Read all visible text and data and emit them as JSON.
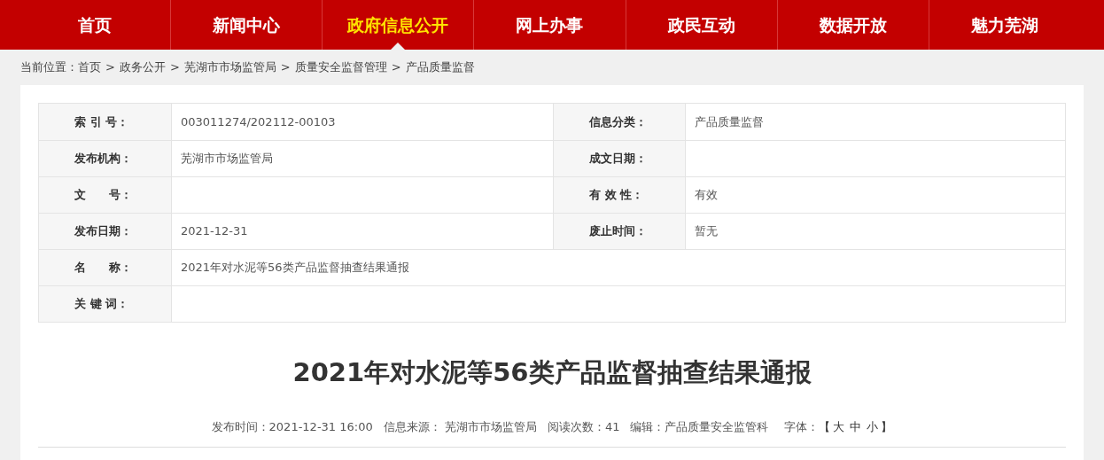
{
  "nav": [
    {
      "label": "首页",
      "selected": false
    },
    {
      "label": "新闻中心",
      "selected": false
    },
    {
      "label": "政府信息公开",
      "selected": true
    },
    {
      "label": "网上办事",
      "selected": false
    },
    {
      "label": "政民互动",
      "selected": false
    },
    {
      "label": "数据开放",
      "selected": false
    },
    {
      "label": "魅力芜湖",
      "selected": false
    }
  ],
  "breadcrumb": {
    "prefix": "当前位置：",
    "items": [
      "首页",
      "政务公开",
      "芜湖市市场监管局",
      "质量安全监督管理",
      "产品质量监督"
    ],
    "separator": ">"
  },
  "info_table": [
    {
      "cells": [
        {
          "label": "索 引 号：",
          "value": "003011274/202112-00103"
        },
        {
          "label": "信息分类：",
          "value": "产品质量监督"
        }
      ]
    },
    {
      "cells": [
        {
          "label": "发布机构：",
          "value": "芜湖市市场监管局"
        },
        {
          "label": "成文日期："
        }
      ]
    },
    {
      "cells": [
        {
          "label": "文　　号："
        },
        {
          "label": "有 效 性：",
          "value": "有效"
        }
      ]
    },
    {
      "cells": [
        {
          "label": "发布日期：",
          "value": "2021-12-31"
        },
        {
          "label": "废止时间：",
          "value": "暂无"
        }
      ]
    },
    {
      "cells": [
        {
          "label": "名　　称：",
          "value": "2021年对水泥等56类产品监督抽查结果通报"
        }
      ]
    },
    {
      "cells": [
        {
          "label": "关 键 词："
        }
      ]
    }
  ],
  "article": {
    "title": "2021年对水泥等56类产品监督抽查结果通报",
    "meta": [
      "发布时间：2021-12-31 16:00",
      "信息来源： 芜湖市市场监管局",
      "阅读次数：41",
      "编辑：产品质量安全监管科"
    ],
    "font_size": {
      "label": "字体：",
      "open": "【",
      "sizes": [
        "大",
        "中",
        "小"
      ],
      "close": "】"
    }
  }
}
